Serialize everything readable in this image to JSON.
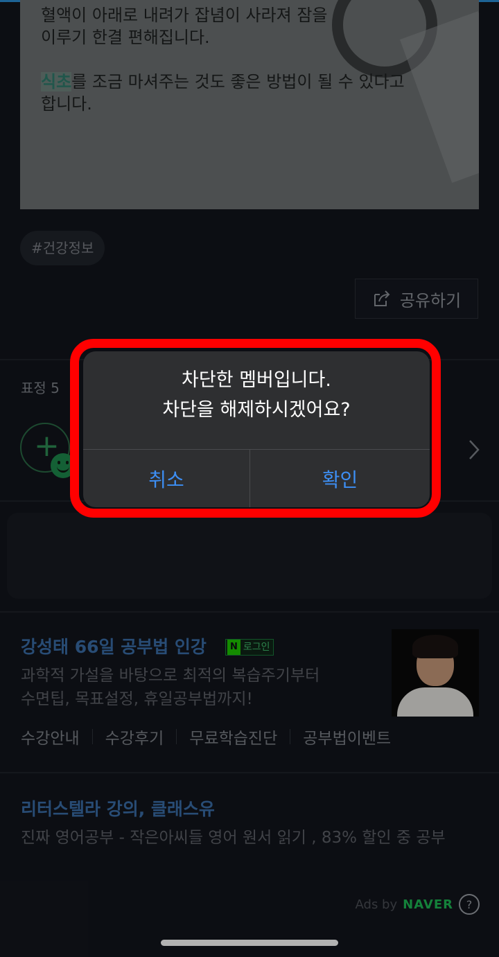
{
  "article": {
    "line1": "혈액이 아래로 내려가 잡념이 사라져 잠을",
    "line2": "이루기 한결 편해집니다.",
    "hl_word": "식초",
    "line3_rest": "를 조금 마셔주는 것도 좋은 방법이 될 수 있다고",
    "line4": "합니다."
  },
  "hashtag": "#건강정보",
  "share_label": "공유하기",
  "reaction_label": "표정 5",
  "ad1": {
    "title": "강성태 66일 공부법 인강",
    "badge_n": "N",
    "badge_text": "로그인",
    "desc1": "과학적 가설을 바탕으로 최적의 복습주기부터",
    "desc2": "수면팁, 목표설정, 휴일공부법까지!",
    "links": [
      "수강안내",
      "수강후기",
      "무료학습진단",
      "공부법이벤트"
    ]
  },
  "ad2": {
    "title": "리터스텔라 강의, 클래스유",
    "desc": "진짜 영어공부 - 작은아씨들 영어 원서 읽기 , 83% 할인 중 공부"
  },
  "ads_by": "Ads by",
  "naver": "NAVER",
  "help": "?",
  "alert": {
    "line1": "차단한 멤버입니다.",
    "line2": "차단을 해제하시겠어요?",
    "cancel": "취소",
    "confirm": "확인"
  },
  "colors": {
    "accent_blue": "#3d8ff5",
    "highlight_outline": "#ff0000",
    "naver_green": "#1db954"
  }
}
